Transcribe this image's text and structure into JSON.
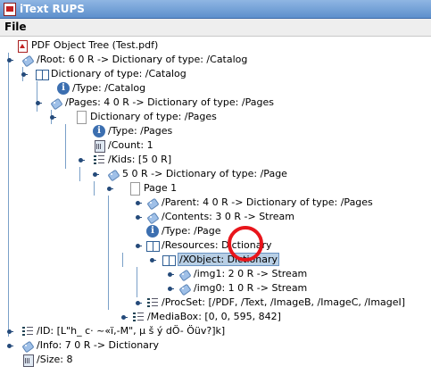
{
  "window": {
    "title": "iText RUPS"
  },
  "menu": {
    "file": "File"
  },
  "tree": {
    "nodes": [
      {
        "id": "root-file",
        "label": "PDF Object Tree (Test.pdf)",
        "icon": "pdf-file-icon"
      },
      {
        "id": "root",
        "label": "/Root: 6 0 R -> Dictionary of type: /Catalog",
        "icon": "tag-icon"
      },
      {
        "id": "catalog-dict",
        "label": "Dictionary of type: /Catalog",
        "icon": "dictionary-book-icon"
      },
      {
        "id": "type-catalog",
        "label": "/Type: /Catalog",
        "icon": "info-icon"
      },
      {
        "id": "pages",
        "label": "/Pages: 4 0 R -> Dictionary of type: /Pages",
        "icon": "tag-icon"
      },
      {
        "id": "pages-dict",
        "label": "Dictionary of type: /Pages",
        "icon": "page-icon"
      },
      {
        "id": "type-pages",
        "label": "/Type: /Pages",
        "icon": "info-icon"
      },
      {
        "id": "count",
        "label": "/Count: 1",
        "icon": "number-icon"
      },
      {
        "id": "kids",
        "label": "/Kids: [5 0 R]",
        "icon": "array-icon"
      },
      {
        "id": "kid-5",
        "label": "5 0 R -> Dictionary of type: /Page",
        "icon": "tag-icon"
      },
      {
        "id": "page-1",
        "label": "Page 1",
        "icon": "page-icon"
      },
      {
        "id": "parent",
        "label": "/Parent: 4 0 R -> Dictionary of type: /Pages",
        "icon": "tag-icon"
      },
      {
        "id": "contents",
        "label": "/Contents: 3 0 R -> Stream",
        "icon": "tag-icon"
      },
      {
        "id": "type-page",
        "label": "/Type: /Page",
        "icon": "info-icon"
      },
      {
        "id": "resources",
        "label": "/Resources: Dictionary",
        "icon": "dictionary-book-icon"
      },
      {
        "id": "xobject",
        "label": "/XObject: Dictionary",
        "icon": "dictionary-book-icon"
      },
      {
        "id": "img1",
        "label": "/img1: 2 0 R -> Stream",
        "icon": "tag-icon"
      },
      {
        "id": "img0",
        "label": "/img0: 1 0 R -> Stream",
        "icon": "tag-icon"
      },
      {
        "id": "procset",
        "label": "/ProcSet: [/PDF, /Text, /ImageB, /ImageC, /ImageI]",
        "icon": "array-icon"
      },
      {
        "id": "mediabox",
        "label": "/MediaBox: [0, 0, 595, 842]",
        "icon": "array-icon"
      },
      {
        "id": "id",
        "label": "/ID: [L\"h_ c· ~«ï,-M\", µ š ý dÖ- Öüv?]k]",
        "icon": "array-icon"
      },
      {
        "id": "info",
        "label": "/Info: 7 0 R -> Dictionary",
        "icon": "tag-icon"
      },
      {
        "id": "size",
        "label": "/Size: 8",
        "icon": "number-icon"
      }
    ]
  },
  "colors": {
    "selection": "#b8cfe5",
    "highlight_ring": "#e8151b",
    "titlebar": "#5d8fcc"
  }
}
